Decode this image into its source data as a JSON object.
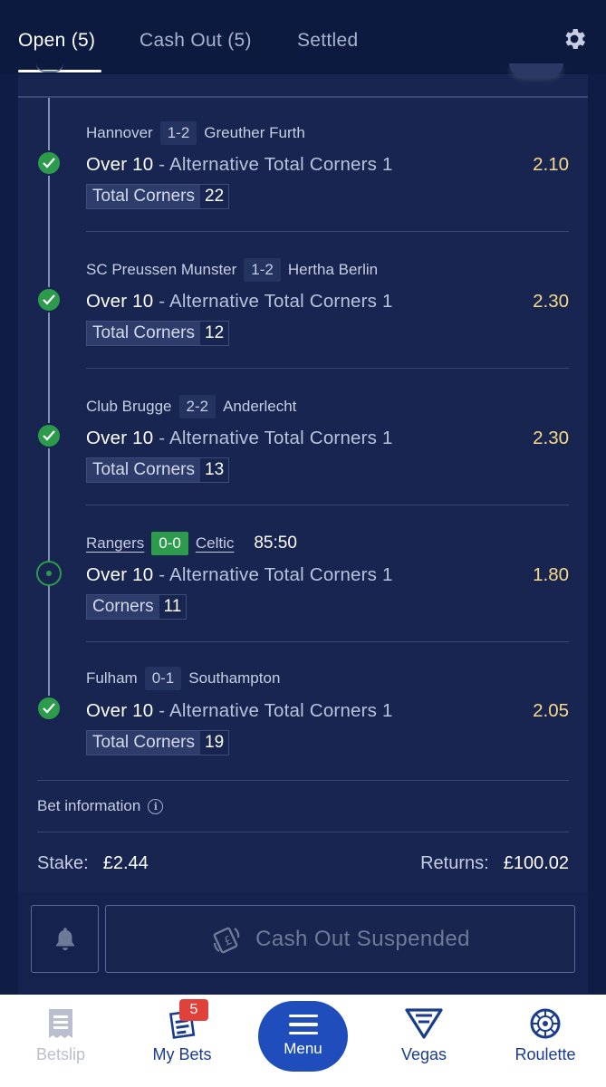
{
  "tabs": [
    {
      "label": "Open (5)",
      "active": true
    },
    {
      "label": "Cash Out (5)",
      "active": false
    },
    {
      "label": "Settled",
      "active": false
    }
  ],
  "settings_icon": "gear-icon",
  "legs": [
    {
      "home": "Hannover",
      "score": "1-2",
      "away": "Greuther Furth",
      "selection": "Over 10",
      "separator": "-",
      "market": "Alternative Total Corners 1",
      "odds": "2.10",
      "stat_label": "Total Corners",
      "stat_value": "22",
      "status": "won"
    },
    {
      "home": "SC Preussen Munster",
      "score": "1-2",
      "away": "Hertha Berlin",
      "selection": "Over 10",
      "separator": "-",
      "market": "Alternative Total Corners 1",
      "odds": "2.30",
      "stat_label": "Total Corners",
      "stat_value": "12",
      "status": "won"
    },
    {
      "home": "Club Brugge",
      "score": "2-2",
      "away": "Anderlecht",
      "selection": "Over 10",
      "separator": "-",
      "market": "Alternative Total Corners 1",
      "odds": "2.30",
      "stat_label": "Total Corners",
      "stat_value": "13",
      "status": "won"
    },
    {
      "home": "Rangers",
      "score": "0-0",
      "away": "Celtic",
      "clock": "85:50",
      "selection": "Over 10",
      "separator": "-",
      "market": "Alternative Total Corners 1",
      "odds": "1.80",
      "stat_label": "Corners",
      "stat_value": "11",
      "status": "live"
    },
    {
      "home": "Fulham",
      "score": "0-1",
      "away": "Southampton",
      "selection": "Over 10",
      "separator": "-",
      "market": "Alternative Total Corners 1",
      "odds": "2.05",
      "stat_label": "Total Corners",
      "stat_value": "19",
      "status": "won"
    }
  ],
  "bet_info_label": "Bet information",
  "stake_label": "Stake:",
  "stake_value": "£2.44",
  "returns_label": "Returns:",
  "returns_value": "£100.02",
  "cashout_label": "Cash Out Suspended",
  "nav": {
    "betslip": "Betslip",
    "mybets": "My Bets",
    "mybets_badge": "5",
    "menu": "Menu",
    "vegas": "Vegas",
    "roulette": "Roulette"
  },
  "colors": {
    "background": "#0f1d45",
    "card": "#172550",
    "odds": "#f7d98a",
    "won": "#2c9c4c",
    "brand": "#1f4ebc",
    "badge": "#e0413a"
  }
}
